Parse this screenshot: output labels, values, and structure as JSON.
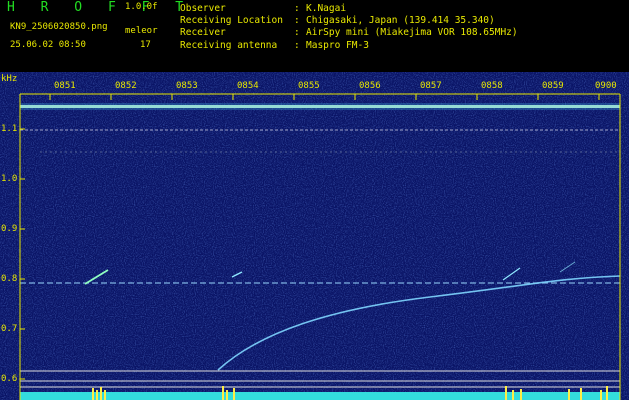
{
  "header": {
    "title": "H R O F F T",
    "version": "1.0.0f",
    "filename": "KN9_2506020850.png",
    "mode_label": "meleor",
    "datetime": "25.06.02 08:50",
    "meteor_count": "17"
  },
  "info": [
    {
      "label": "Observer",
      "value": "K.Nagai"
    },
    {
      "label": "Receiving Location",
      "value": "Chigasaki, Japan (139.414 35.340)"
    },
    {
      "label": "Receiver",
      "value": "AirSpy mini (Miakejima VOR 108.65MHz)"
    },
    {
      "label": "Receiving antenna",
      "value": "Maspro FM-3"
    }
  ],
  "axes": {
    "y_unit": "kHz",
    "y_ticks": [
      "1.1",
      "1.0",
      "0.9",
      "0.8",
      "0.7",
      "0.6"
    ],
    "x_ticks": [
      "0851",
      "0852",
      "0853",
      "0854",
      "0855",
      "0856",
      "0857",
      "0858",
      "0859",
      "0900"
    ]
  },
  "colors": {
    "background": "#0a1466",
    "text": "#e8e800",
    "title": "#22dd22",
    "carrier": "#c8ffd8",
    "echo": "#7fd6ff"
  }
}
